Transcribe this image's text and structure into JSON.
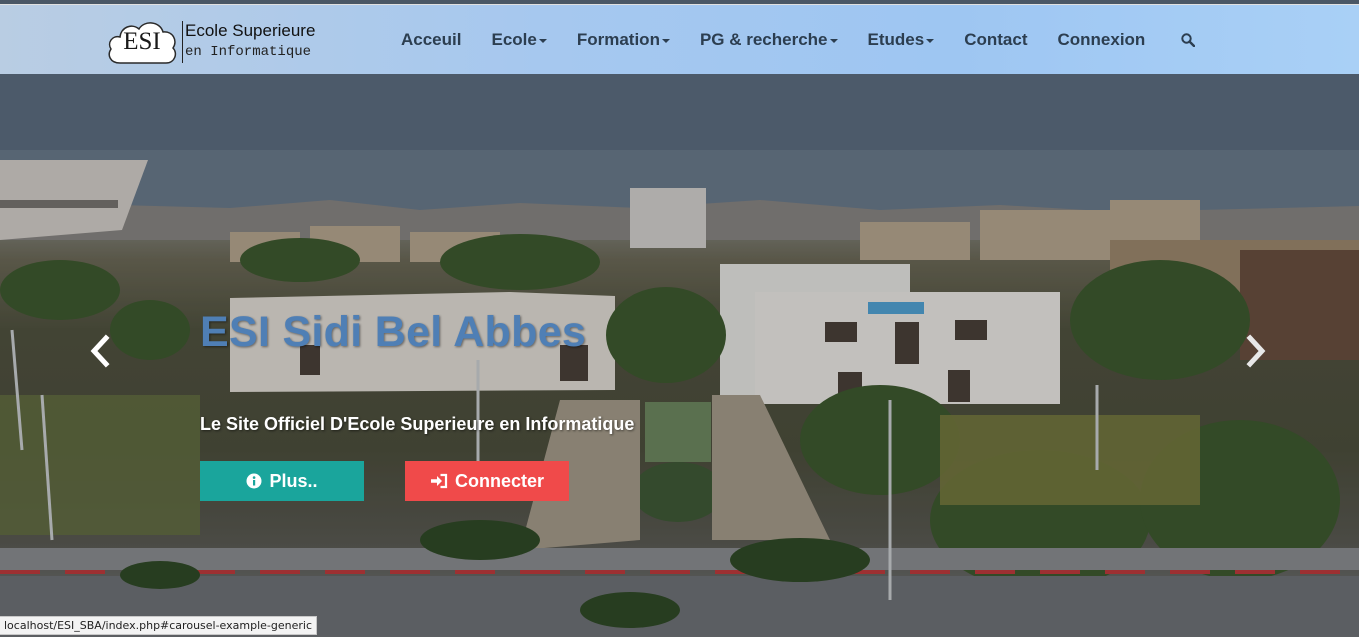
{
  "logo": {
    "abbr": "ESI",
    "line1": "Ecole Superieure",
    "line2": "en Informatique"
  },
  "nav": {
    "items": [
      {
        "label": "Acceuil",
        "dropdown": false
      },
      {
        "label": "Ecole",
        "dropdown": true
      },
      {
        "label": "Formation",
        "dropdown": true
      },
      {
        "label": "PG & recherche",
        "dropdown": true
      },
      {
        "label": "Etudes",
        "dropdown": true
      },
      {
        "label": "Contact",
        "dropdown": false
      },
      {
        "label": "Connexion",
        "dropdown": false
      }
    ],
    "search_icon": "search-icon"
  },
  "carousel": {
    "headline": "ESI Sidi Bel Abbes",
    "subtitle": "Le Site Officiel D'Ecole Superieure en Informatique",
    "buttons": {
      "plus": {
        "label": "Plus..",
        "icon": "info-circle-icon",
        "color": "#1aa59c"
      },
      "connect": {
        "label": "Connecter",
        "icon": "sign-in-icon",
        "color": "#f04a4a"
      }
    },
    "prev_icon": "chevron-left-icon",
    "next_icon": "chevron-right-icon"
  },
  "status_bar": {
    "url": "localhost/ESI_SBA/index.php#carousel-example-generic"
  },
  "colors": {
    "nav_text": "#2c3e50",
    "headline": "#4f7fb5"
  }
}
